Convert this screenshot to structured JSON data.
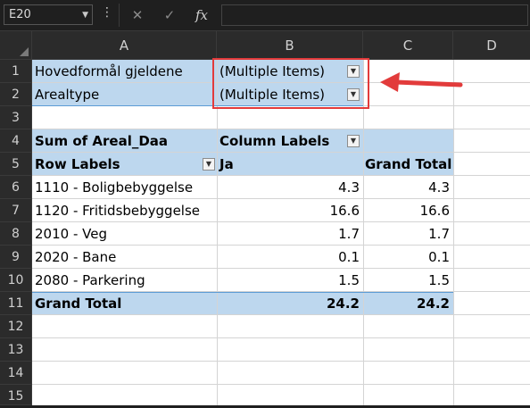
{
  "formula_bar": {
    "name_box": "E20",
    "name_box_arrow": "▼",
    "more_icon": "⋮",
    "cancel_icon": "✕",
    "enter_icon": "✓",
    "function_icon": "fx",
    "formula": ""
  },
  "columns": [
    "A",
    "B",
    "C",
    "D"
  ],
  "rows": [
    "1",
    "2",
    "3",
    "4",
    "5",
    "6",
    "7",
    "8",
    "9",
    "10",
    "11",
    "12",
    "13",
    "14",
    "15"
  ],
  "filters": {
    "row1_label": "Hovedformål gjeldene",
    "row1_value": "(Multiple Items)",
    "row2_label": "Arealtype",
    "row2_value": "(Multiple Items)"
  },
  "pivot": {
    "values_label": "Sum of Areal_Daa",
    "column_labels": "Column Labels",
    "row_labels": "Row Labels",
    "col_ja": "Ja",
    "col_grand_total": "Grand Total",
    "data_rows": [
      {
        "label": "1110 - Boligbebyggelse",
        "ja": "4.3",
        "total": "4.3"
      },
      {
        "label": "1120 - Fritidsbebyggelse",
        "ja": "16.6",
        "total": "16.6"
      },
      {
        "label": "2010 - Veg",
        "ja": "1.7",
        "total": "1.7"
      },
      {
        "label": "2020 - Bane",
        "ja": "0.1",
        "total": "0.1"
      },
      {
        "label": "2080 - Parkering",
        "ja": "1.5",
        "total": "1.5"
      }
    ],
    "grand_total_label": "Grand Total",
    "grand_total_ja": "24.2",
    "grand_total_total": "24.2"
  },
  "colors": {
    "pivot_fill": "#bdd7ee",
    "annotation_red": "#e23b3b",
    "header_bg": "#2b2b2b"
  }
}
